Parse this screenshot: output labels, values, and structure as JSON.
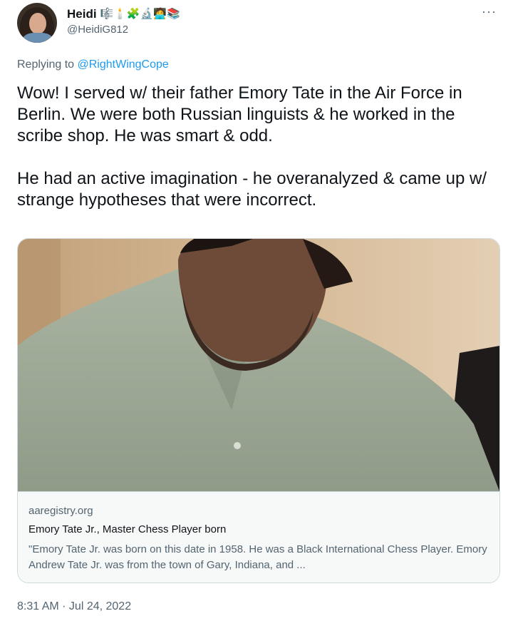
{
  "author": {
    "name": "Heidi",
    "handle": "@HeidiG812",
    "name_emojis": "🎼🕯️🧩🔬🧑‍💻📚"
  },
  "reply": {
    "prefix": "Replying to",
    "mention": "@RightWingCope"
  },
  "tweet": {
    "paragraph_1": "Wow! I served w/ their father Emory Tate in the Air Force in Berlin. We were both Russian linguists & he worked in the scribe shop. He was smart & odd.",
    "paragraph_2": "He had an active imagination - he overanalyzed & came up w/ strange hypotheses that were incorrect."
  },
  "card": {
    "domain": "aaregistry.org",
    "title": "Emory Tate Jr., Master Chess Player born",
    "description": "\"Emory Tate Jr. was born on this date in 1958. He was a Black International Chess Player. Emory Andrew Tate Jr. was from the town of Gary, Indiana, and ..."
  },
  "timestamp": "8:31 AM · Jul 24, 2022",
  "icons": {
    "more": "more-options-icon",
    "avatar": "profile-avatar"
  },
  "colors": {
    "link": "#1d9bf0",
    "secondary_text": "#536471",
    "border": "#cfd9de"
  }
}
